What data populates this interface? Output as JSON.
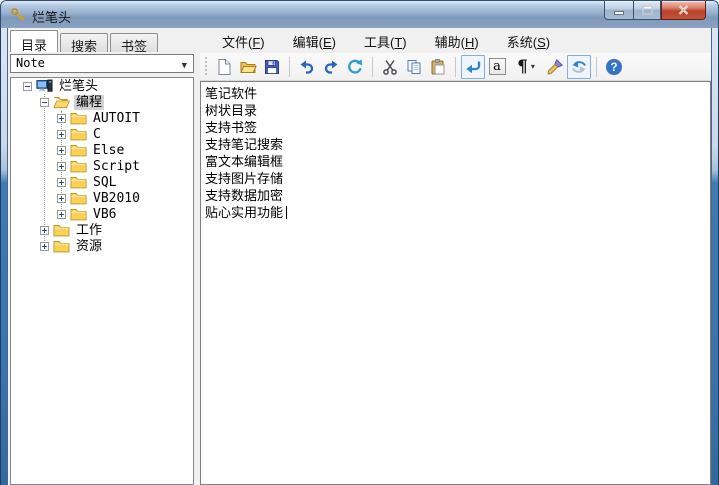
{
  "window": {
    "title": "烂笔头"
  },
  "titlebar": {
    "buttons": {
      "minimize": "minimize",
      "maximize": "maximize",
      "close": "close"
    }
  },
  "left_panel": {
    "tabs": [
      {
        "label": "目录",
        "active": true
      },
      {
        "label": "搜索",
        "active": false
      },
      {
        "label": "书签",
        "active": false
      }
    ],
    "notebook_select": {
      "value": "Note",
      "dropdown_glyph": "▼"
    },
    "tree": {
      "items": [
        {
          "label": "烂笔头",
          "level": 0,
          "expander": "minus",
          "icon": "computer",
          "selected": false
        },
        {
          "label": "编程",
          "level": 1,
          "expander": "minus",
          "icon": "folder-open",
          "selected": true
        },
        {
          "label": "AUTOIT",
          "level": 2,
          "expander": "plus",
          "icon": "folder",
          "selected": false
        },
        {
          "label": "C",
          "level": 2,
          "expander": "plus",
          "icon": "folder",
          "selected": false
        },
        {
          "label": "Else",
          "level": 2,
          "expander": "plus",
          "icon": "folder",
          "selected": false
        },
        {
          "label": "Script",
          "level": 2,
          "expander": "plus",
          "icon": "folder",
          "selected": false
        },
        {
          "label": "SQL",
          "level": 2,
          "expander": "plus",
          "icon": "folder",
          "selected": false
        },
        {
          "label": "VB2010",
          "level": 2,
          "expander": "plus",
          "icon": "folder",
          "selected": false
        },
        {
          "label": "VB6",
          "level": 2,
          "expander": "plus",
          "icon": "folder",
          "selected": false
        },
        {
          "label": "工作",
          "level": 1,
          "expander": "plus",
          "icon": "folder",
          "selected": false
        },
        {
          "label": "资源",
          "level": 1,
          "expander": "plus",
          "icon": "folder",
          "selected": false
        }
      ]
    }
  },
  "menubar": {
    "items": [
      {
        "pre": "文件(",
        "key": "F",
        "post": ")"
      },
      {
        "pre": "编辑(",
        "key": "E",
        "post": ")"
      },
      {
        "pre": "工具(",
        "key": "T",
        "post": ")"
      },
      {
        "pre": "辅助(",
        "key": "H",
        "post": ")"
      },
      {
        "pre": "系统(",
        "key": "S",
        "post": ")"
      }
    ]
  },
  "toolbar": {
    "buttons": [
      "new-document",
      "open-folder",
      "save",
      "undo",
      "redo",
      "refresh",
      "cut",
      "copy",
      "paste",
      "word-wrap",
      "font-a",
      "paragraph-marks",
      "format-painter",
      "flip-arrows",
      "help"
    ],
    "toggled_buttons": [
      "word-wrap",
      "flip-arrows"
    ],
    "font_button_label": "a",
    "paragraph_glyph": "¶",
    "dropdown_glyph": "▾",
    "help_glyph": "?"
  },
  "editor": {
    "lines": [
      "笔记软件",
      "树状目录",
      "支持书签",
      "支持笔记搜索",
      "富文本编辑框",
      "支持图片存储",
      "支持数据加密",
      "贴心实用功能"
    ]
  },
  "colors": {
    "titlebar_blue": "#8fa9c8",
    "frame_blue": "#3a73ad",
    "close_red": "#c1523a",
    "client_grey": "#f0f0f0",
    "toggle_border_blue": "#86aedd",
    "folder_yellow": "#fbd255",
    "selection_grey": "#d2d2d2"
  }
}
